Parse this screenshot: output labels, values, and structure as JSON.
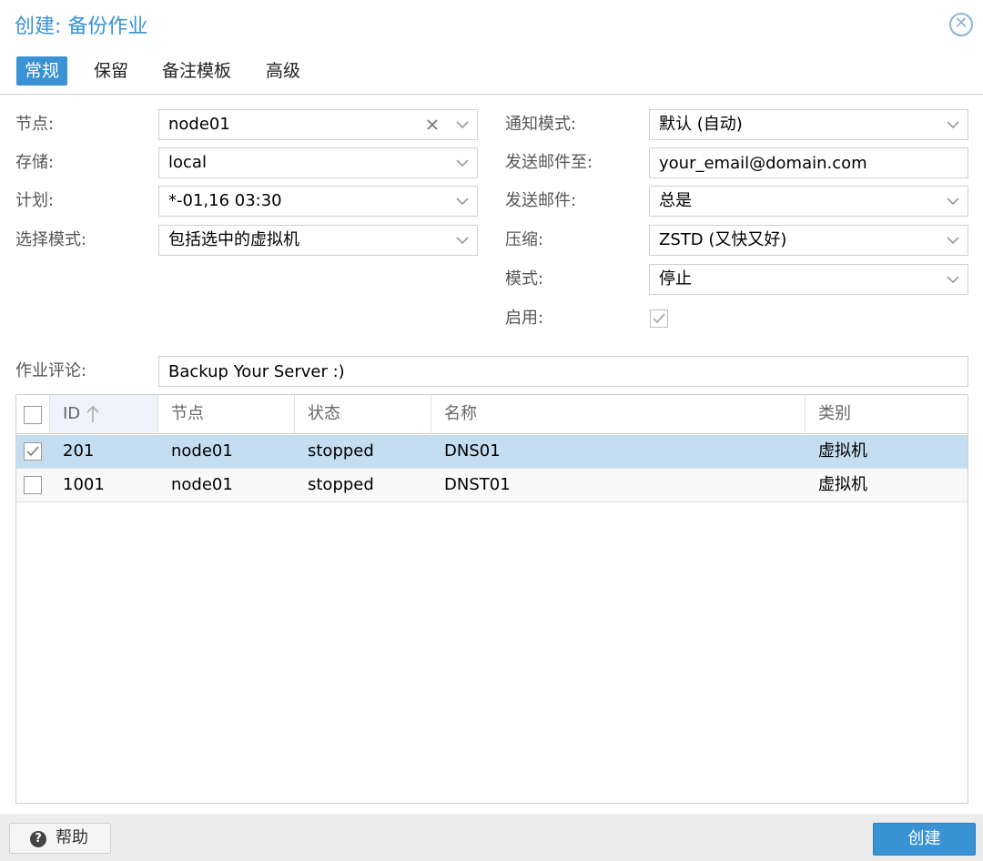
{
  "dialog": {
    "title": "创建: 备份作业",
    "close_icon": "close-circle-icon"
  },
  "tabs": [
    {
      "label": "常规",
      "active": true
    },
    {
      "label": "保留",
      "active": false
    },
    {
      "label": "备注模板",
      "active": false
    },
    {
      "label": "高级",
      "active": false
    }
  ],
  "left_form": {
    "node": {
      "label": "节点:",
      "value": "node01"
    },
    "storage": {
      "label": "存储:",
      "value": "local"
    },
    "schedule": {
      "label": "计划:",
      "value": "*-01,16 03:30"
    },
    "selection_mode": {
      "label": "选择模式:",
      "value": "包括选中的虚拟机"
    }
  },
  "right_form": {
    "notification_mode": {
      "label": "通知模式:",
      "value": "默认 (自动)"
    },
    "send_email_to": {
      "label": "发送邮件至:",
      "value": "your_email@domain.com"
    },
    "send_email": {
      "label": "发送邮件:",
      "value": "总是"
    },
    "compression": {
      "label": "压缩:",
      "value": "ZSTD (又快又好)"
    },
    "mode": {
      "label": "模式:",
      "value": "停止"
    },
    "enabled": {
      "label": "启用:",
      "checked": true
    }
  },
  "comment": {
    "label": "作业评论:",
    "value": "Backup Your Server :)"
  },
  "grid": {
    "columns": [
      "ID",
      "节点",
      "状态",
      "名称",
      "类别"
    ],
    "sort_icon": "arrow-up-icon",
    "rows": [
      {
        "checked": true,
        "id": "201",
        "node": "node01",
        "status": "stopped",
        "name": "DNS01",
        "type": "虚拟机"
      },
      {
        "checked": false,
        "id": "1001",
        "node": "node01",
        "status": "stopped",
        "name": "DNST01",
        "type": "虚拟机"
      }
    ]
  },
  "footer": {
    "help_label": "帮助",
    "help_icon": "question-circle-icon",
    "create_label": "创建"
  },
  "colors": {
    "accent": "#3892d4",
    "selected_row": "#c4ddf0"
  }
}
